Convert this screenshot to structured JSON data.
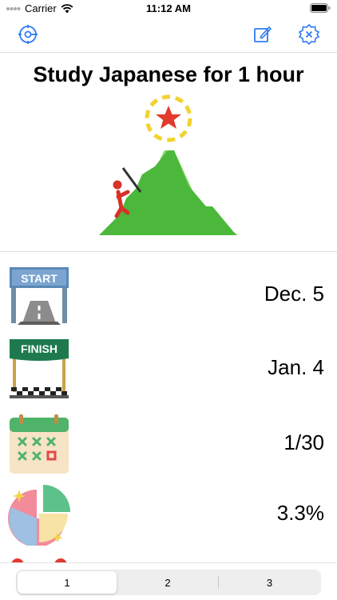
{
  "status_bar": {
    "carrier": "Carrier",
    "time": "11:12 AM"
  },
  "toolbar": {
    "left_icon": "settings-gear-icon",
    "edit_icon": "edit-square-icon",
    "delete_icon": "gear-x-icon",
    "accent_color": "#2E7BF6"
  },
  "goal": {
    "title": "Study Japanese for 1 hour"
  },
  "stats": [
    {
      "icon": "start-gate-icon",
      "value": "Dec. 5"
    },
    {
      "icon": "finish-gate-icon",
      "value": "Jan. 4"
    },
    {
      "icon": "calendar-icon",
      "value": "1/30"
    },
    {
      "icon": "pie-chart-icon",
      "value": "3.3%"
    }
  ],
  "tabs": [
    "1",
    "2",
    "3"
  ],
  "selected_tab": 0
}
